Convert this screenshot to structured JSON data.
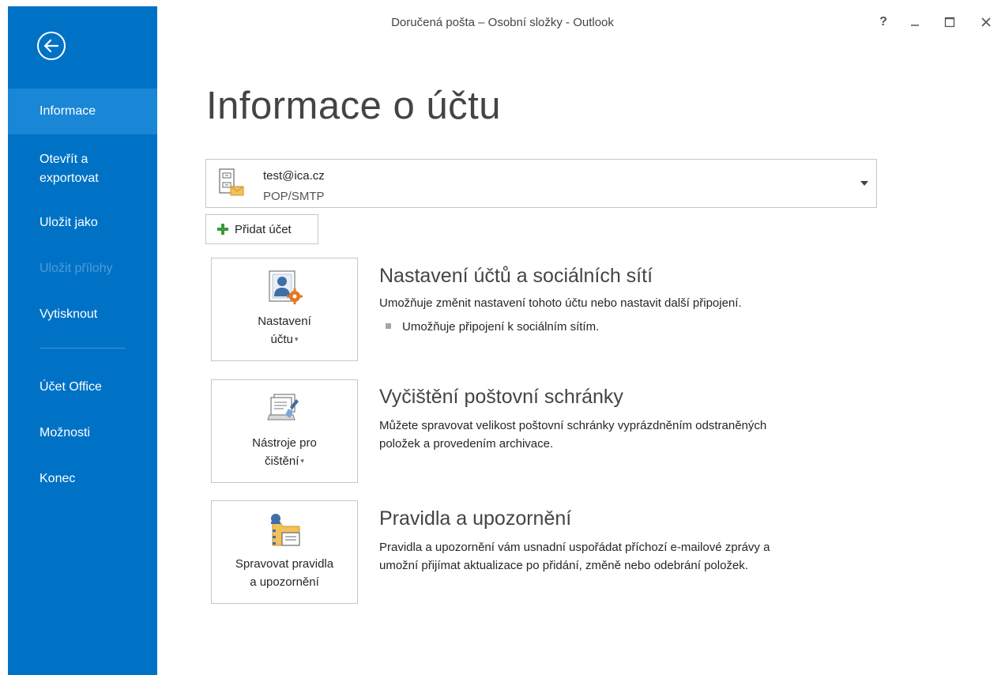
{
  "window": {
    "title": "Doručená pošta – Osobní složky - Outlook",
    "help_label": "?",
    "minimize_label": "–",
    "maximize_label": "☐",
    "close_label": "✕"
  },
  "colors": {
    "sidebar_bg": "#0072c6",
    "sidebar_active": "#1a86d6",
    "sidebar_disabled_text": "#4d9bd8",
    "plus_green": "#3a9a3a",
    "gear_orange": "#e7781f"
  },
  "sidebar": {
    "back_icon": "back-arrow-icon",
    "items": [
      {
        "label": "Informace",
        "active": true
      },
      {
        "label": "Otevřít a exportovat"
      },
      {
        "label": "Uložit jako"
      },
      {
        "label": "Uložit přílohy",
        "disabled": true
      },
      {
        "label": "Vytisknout"
      },
      {
        "label": "Účet Office"
      },
      {
        "label": "Možnosti"
      },
      {
        "label": "Konec"
      }
    ],
    "item_line1": "Otevřít a",
    "item_line2": "exportovat"
  },
  "main": {
    "page_title": "Informace o účtu",
    "account": {
      "email": "test@ica.cz",
      "type": "POP/SMTP"
    },
    "add_account_label": "Přidat účet",
    "sections": [
      {
        "tile_line1": "Nastavení",
        "tile_line2": "účtu",
        "tile_has_caret": true,
        "title": "Nastavení účtů a sociálních sítí",
        "description": "Umožňuje změnit nastavení tohoto účtu nebo nastavit další připojení.",
        "bullet": "Umožňuje připojení k sociálním sítím."
      },
      {
        "tile_line1": "Nástroje pro",
        "tile_line2": "čištění",
        "tile_has_caret": true,
        "title": "Vyčištění poštovní schránky",
        "description_line1": "Můžete spravovat velikost poštovní schránky vyprázdněním odstraněných",
        "description_line2": "položek a provedením archivace."
      },
      {
        "tile_line1": "Spravovat pravidla",
        "tile_line2": "a upozornění",
        "title": "Pravidla a upozornění",
        "description_line1": "Pravidla a upozornění vám usnadní uspořádat příchozí e-mailové zprávy a",
        "description_line2": "umožní přijímat aktualizace po přidání, změně nebo odebrání položek."
      }
    ],
    "caret_glyph": "▾"
  }
}
